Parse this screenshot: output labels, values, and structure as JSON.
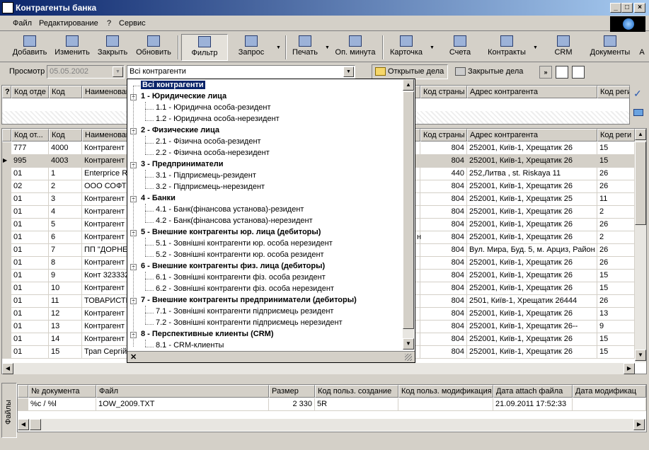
{
  "window": {
    "title": "Контрагенты банка"
  },
  "menu": [
    "Файл",
    "Редактирование",
    "?",
    "Сервис"
  ],
  "toolbar": [
    {
      "label": "Добавить",
      "icon": "add-icon"
    },
    {
      "label": "Изменить",
      "icon": "edit-icon"
    },
    {
      "label": "Закрыть",
      "icon": "close-doc-icon"
    },
    {
      "label": "Обновить",
      "icon": "refresh-icon"
    },
    {
      "label": "Фильтр",
      "icon": "filter-icon"
    },
    {
      "label": "Запрос",
      "icon": "query-icon"
    },
    {
      "label": "Печать",
      "icon": "printer-icon"
    },
    {
      "label": "Оп. минута",
      "icon": "info-icon"
    },
    {
      "label": "Карточка",
      "icon": "card-icon"
    },
    {
      "label": "Счета",
      "icon": "accounts-icon"
    },
    {
      "label": "Контракты",
      "icon": "contracts-icon"
    },
    {
      "label": "CRM",
      "icon": "crm-icon"
    },
    {
      "label": "Документы",
      "icon": "documents-icon"
    },
    {
      "label": "A",
      "icon": ""
    }
  ],
  "filterbar": {
    "view_label": "Просмотр",
    "date": "05.05.2002",
    "selector": "Всі контрагенти",
    "open_btn": "Открытые дела",
    "closed_btn": "Закрытые дела"
  },
  "filter_grid": {
    "mark": "?",
    "headers": [
      "Код отде",
      "Код",
      "Наименован",
      "Код страны",
      "Адрес контрагента",
      "Код реги"
    ]
  },
  "main_grid": {
    "headers": [
      "Код от...",
      "Код",
      "Наименован",
      "Код страны",
      "Адрес контрагента",
      "Код реги"
    ],
    "rows": [
      [
        "777",
        "4000",
        "Контрагент",
        "804",
        "252001, Київ-1, Хрещатик 26",
        "15"
      ],
      [
        "995",
        "4003",
        "Контрагент",
        "804",
        "252001, Київ-1, Хрещатик 26",
        "15"
      ],
      [
        "01",
        "1",
        "Enterprice Ri",
        "440",
        "252,Литва , st. Riskaya 11",
        "26"
      ],
      [
        "02",
        "2",
        "ООО СОФТ Р",
        "804",
        "252001, Київ-1, Хрещатик 26",
        "26"
      ],
      [
        "01",
        "3",
        "Контрагент",
        "804",
        "252001, Київ-1, Хрещатик 25",
        "11"
      ],
      [
        "01",
        "4",
        "Контрагент",
        "804",
        "252001, Київ-1, Хрещатик 26",
        "2"
      ],
      [
        "01",
        "5",
        "Контрагент",
        "804",
        "252001, Київ-1, Хрещатик 26",
        "26"
      ],
      [
        "01",
        "6",
        "Контрагент",
        "804",
        "252001, Київ-1, Хрещатик 26",
        "2"
      ],
      [
        "01",
        "7",
        "ПП \"ДОРНЕЛ",
        "804",
        "Вул. Мира, Буд. 5, м. Арциз, Район Г",
        "26"
      ],
      [
        "01",
        "8",
        "Контрагент",
        "804",
        "252001, Київ-1, Хрещатик 26",
        "26"
      ],
      [
        "01",
        "9",
        "Конт 323332",
        "804",
        "252001, Київ-1, Хрещатик 26",
        "15"
      ],
      [
        "01",
        "10",
        "Контрагент",
        "804",
        "252001, Київ-1, Хрещатик 26",
        "15"
      ],
      [
        "01",
        "11",
        "ТОВАРИСТВС",
        "804",
        "2501, Київ-1, Хрещатик 26444",
        "26"
      ],
      [
        "01",
        "12",
        "Контрагент",
        "804",
        "252001, Київ-1, Хрещатик 26",
        "13"
      ],
      [
        "01",
        "13",
        "Контрагент",
        "804",
        "252001, Київ-1, Хрещатик 26--",
        "9"
      ],
      [
        "01",
        "14",
        "Контрагент",
        "804",
        "252001, Київ-1, Хрещатик 26",
        "15"
      ],
      [
        "01",
        "15",
        "Трап Сергій",
        "804",
        "252001, Київ-1, Хрещатик 26",
        "15"
      ]
    ],
    "partial_text": "н"
  },
  "tree": {
    "root": "Всі контрагенти",
    "groups": [
      {
        "label": "1 - Юридические лица",
        "items": [
          "1.1 - Юридична особа-резидент",
          "1.2 - Юридична особа-нерезидент"
        ]
      },
      {
        "label": "2 - Физические лица",
        "items": [
          "2.1 - Фізична особа-резидент",
          "2.2 - Фізична особа-нерезидент"
        ]
      },
      {
        "label": "3 - Предприниматели",
        "items": [
          "3.1 - Підприємець-резидент",
          "3.2 - Підприємець-нерезидент"
        ]
      },
      {
        "label": "4 - Банки",
        "items": [
          "4.1 - Банк(фінансова установа)-резидент",
          "4.2 - Банк(фінансова установа)-нерезидент"
        ]
      },
      {
        "label": "5 - Внешние контрагенты юр. лица (дебиторы)",
        "items": [
          "5.1 - Зовнішні контрагенти юр. особа нерезидент",
          "5.2 - Зовнішні контрагенти юр. особа резидент"
        ]
      },
      {
        "label": "6 - Внешние контрагенты физ. лица (дебиторы)",
        "items": [
          "6.1 - Зовнішні контрагенти фіз. особа резидент",
          "6.2 - Зовнішні контрагенти фіз. особа нерезидент"
        ]
      },
      {
        "label": "7 - Внешние контрагенты предприниматели (дебиторы)",
        "items": [
          "7.1 - Зовнішні контрагенти підприємець резидент",
          "7.2 - Зовнішні контрагенти підприємець нерезидент"
        ]
      },
      {
        "label": "8 - Перспективные клиенты (CRM)",
        "items": [
          "8.1 - CRM-клиенты"
        ]
      }
    ],
    "close_glyph": "✕"
  },
  "files": {
    "tab_label": "Файлы",
    "headers": [
      "№ документа",
      "Файл",
      "Размер",
      "Код польз. создание",
      "Код польз. модификация",
      "Дата attach файла",
      "Дата модификац"
    ],
    "row": [
      "%с / %l",
      "1OW_2009.TXT",
      "2 330",
      "5R",
      "",
      "21.09.2011 17:52:33",
      ""
    ]
  },
  "colors": {
    "title": "#0a246a",
    "selection": "#0a246a",
    "face": "#d4d0c8"
  }
}
